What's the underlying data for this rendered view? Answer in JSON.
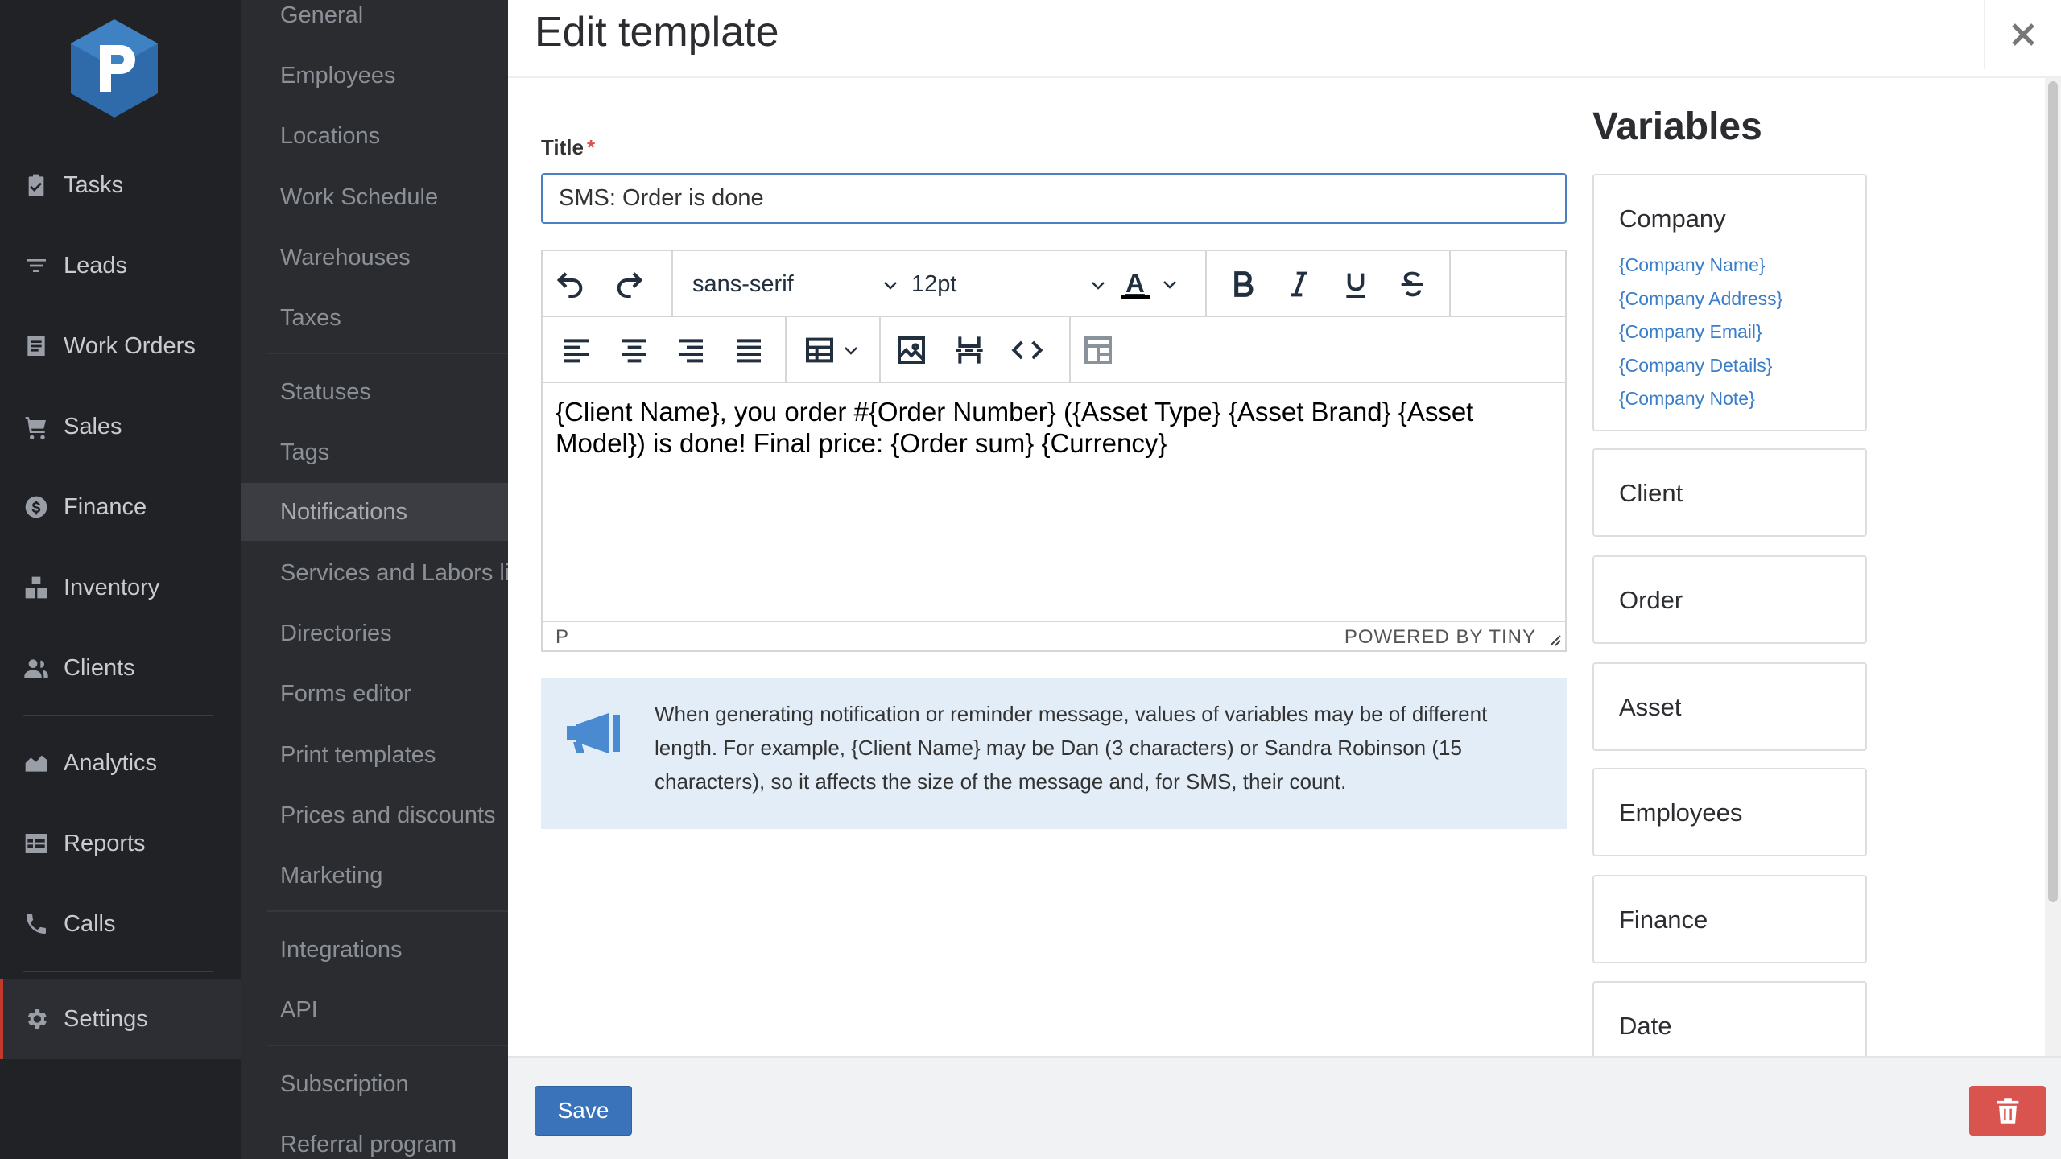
{
  "nav": {
    "items": [
      {
        "label": "Tasks",
        "icon": "clipboard-check-icon"
      },
      {
        "label": "Leads",
        "icon": "filter-icon"
      },
      {
        "label": "Work Orders",
        "icon": "document-list-icon"
      },
      {
        "label": "Sales",
        "icon": "cart-icon"
      },
      {
        "label": "Finance",
        "icon": "dollar-circle-icon"
      },
      {
        "label": "Inventory",
        "icon": "boxes-icon"
      },
      {
        "label": "Clients",
        "icon": "users-icon"
      },
      {
        "label": "Analytics",
        "icon": "area-chart-icon"
      },
      {
        "label": "Reports",
        "icon": "table-report-icon"
      },
      {
        "label": "Calls",
        "icon": "phone-icon"
      },
      {
        "label": "Settings",
        "icon": "gear-icon"
      }
    ]
  },
  "subnav": {
    "items": [
      "General",
      "Employees",
      "Locations",
      "Work Schedule",
      "Warehouses",
      "Taxes",
      "Statuses",
      "Tags",
      "Notifications",
      "Services and Labors list",
      "Directories",
      "Forms editor",
      "Print templates",
      "Prices and discounts",
      "Marketing",
      "Integrations",
      "API",
      "Subscription",
      "Referral program"
    ],
    "active": "Notifications"
  },
  "panel": {
    "title": "Edit template",
    "title_label": "Title",
    "required_mark": "*",
    "title_value": "SMS: Order is done"
  },
  "editor": {
    "font_family": "sans-serif",
    "font_size": "12pt",
    "text_color_letter": "A",
    "content": "{Client Name}, you order #{Order Number} ({Asset Type} {Asset Brand} {Asset Model}) is done! Final price: {Order sum} {Currency}",
    "status_path": "P",
    "powered_by": "POWERED BY TINY"
  },
  "info": {
    "text": "When generating notification or reminder message, values of variables may be of different length. For example, {Client Name} may be Dan (3 characters) or Sandra Robinson (15 characters), so it affects the size of the message and, for SMS, their count."
  },
  "variables": {
    "title": "Variables",
    "groups": [
      {
        "name": "Company",
        "items": [
          "{Company Name}",
          "{Company Address}",
          "{Company Email}",
          "{Company Details}",
          "{Company Note}"
        ]
      },
      {
        "name": "Client"
      },
      {
        "name": "Order"
      },
      {
        "name": "Asset"
      },
      {
        "name": "Employees"
      },
      {
        "name": "Finance"
      },
      {
        "name": "Date"
      }
    ]
  },
  "footer": {
    "save_label": "Save"
  },
  "colors": {
    "accent": "#3a73ba",
    "danger": "#d9534f",
    "link": "#3a7ec8",
    "info_bg": "#e3edf8",
    "logo": "#2f6bab"
  }
}
